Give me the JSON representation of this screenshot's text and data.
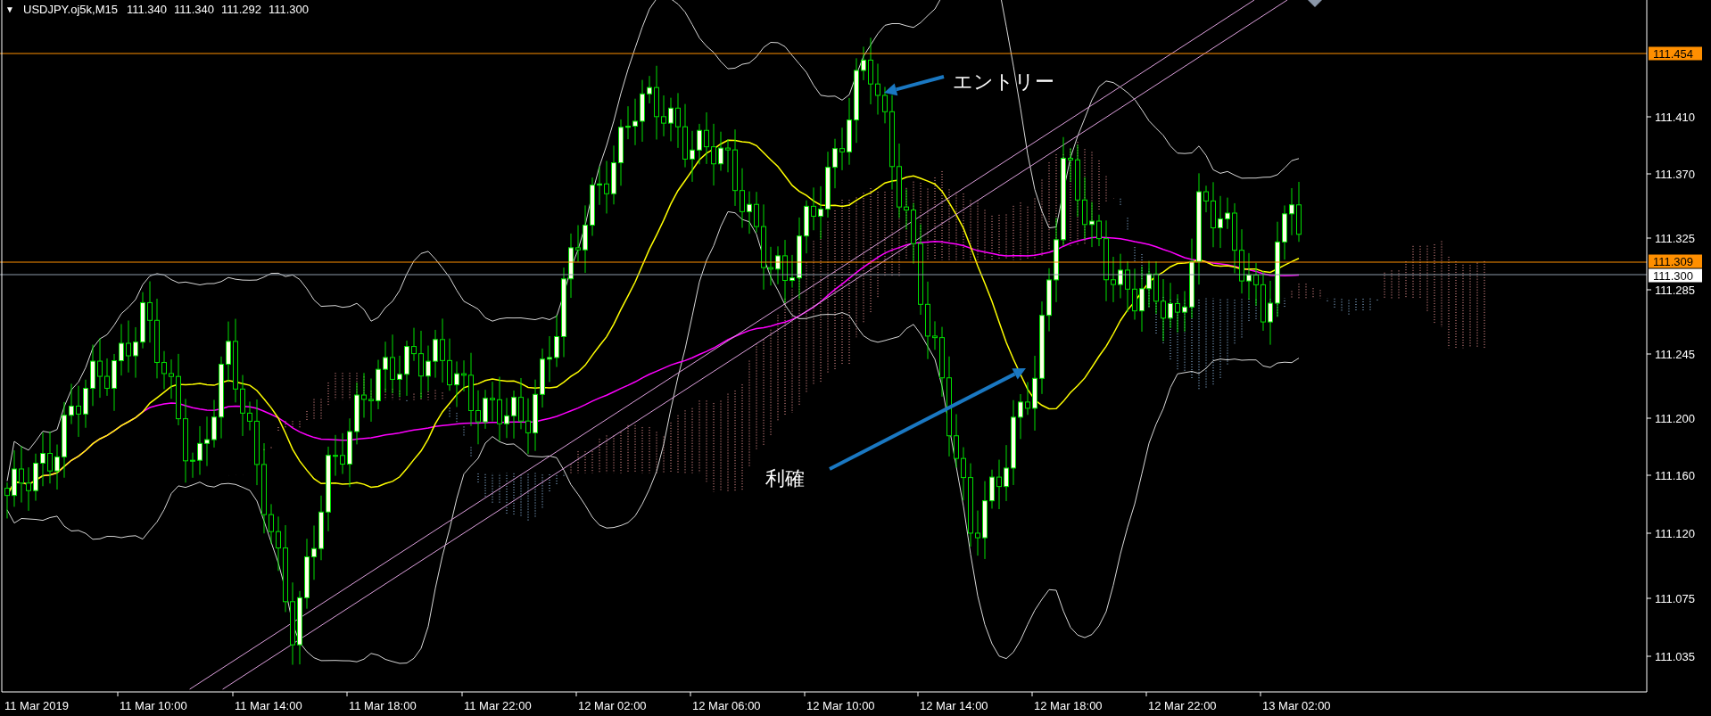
{
  "header": {
    "toggle": "▼",
    "symbol": "USDJPY.oj5k,M15",
    "quote": [
      "111.340",
      "111.340",
      "111.292",
      "111.300"
    ]
  },
  "price_axis": [
    "111.410",
    "111.370",
    "111.325",
    "111.285",
    "111.245",
    "111.200",
    "111.160",
    "111.120",
    "111.075",
    "111.035"
  ],
  "price_tags": [
    {
      "text": "111.454",
      "color": "#ff8f00"
    },
    {
      "text": "111.309",
      "color": "#ff8f00"
    },
    {
      "text": "111.300",
      "color": "#ffffff"
    }
  ],
  "time_axis": [
    "11 Mar 2019",
    "11 Mar 10:00",
    "11 Mar 14:00",
    "11 Mar 18:00",
    "11 Mar 22:00",
    "12 Mar 02:00",
    "12 Mar 06:00",
    "12 Mar 10:00",
    "12 Mar 14:00",
    "12 Mar 18:00",
    "12 Mar 22:00",
    "13 Mar 02:00"
  ],
  "annotations": [
    {
      "text": "エントリー"
    },
    {
      "text": "利確"
    }
  ]
}
